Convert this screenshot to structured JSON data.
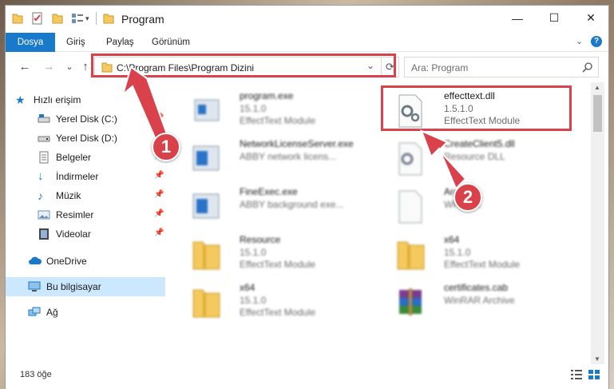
{
  "window": {
    "title": "Program",
    "controls": {
      "minimize": "—",
      "maximize": "☐",
      "close": "✕"
    }
  },
  "ribbon": {
    "tabs": [
      "Dosya",
      "Giriş",
      "Paylaş",
      "Görünüm"
    ],
    "collapse_icon": "chevron-down-icon",
    "help": "?"
  },
  "navigation": {
    "back": "←",
    "forward": "→",
    "recent": "⌄",
    "up": "↑",
    "address": "C:\\Program Files\\Program Dizini",
    "refresh": "⟳",
    "search_placeholder": "Ara: Program"
  },
  "sidebar": {
    "quick_access": "Hızlı erişim",
    "items": [
      {
        "label": "Yerel Disk (C:)",
        "icon": "drive-icon",
        "pinned": true
      },
      {
        "label": "Yerel Disk (D:)",
        "icon": "drive-icon",
        "pinned": true
      },
      {
        "label": "Belgeler",
        "icon": "documents-icon",
        "pinned": true
      },
      {
        "label": "İndirmeler",
        "icon": "downloads-icon",
        "pinned": true
      },
      {
        "label": "Müzik",
        "icon": "music-icon",
        "pinned": true
      },
      {
        "label": "Resimler",
        "icon": "pictures-icon",
        "pinned": true
      },
      {
        "label": "Videolar",
        "icon": "videos-icon",
        "pinned": true
      }
    ],
    "onedrive": "OneDrive",
    "this_pc": "Bu bilgisayar",
    "network": "Ağ"
  },
  "files": [
    {
      "name": "program.exe",
      "line2": "15.1.0",
      "line3": "EffectText Module",
      "icon": "exe-icon"
    },
    {
      "name": "effecttext.dll",
      "line2": "1.5.1.0",
      "line3": "EffectText Module",
      "icon": "dll-gear-icon"
    },
    {
      "name": "NetworkLicenseServer.exe",
      "line2": "ABBY network licens...",
      "line3": "",
      "icon": "exe-icon"
    },
    {
      "name": "CreateClient5.dll",
      "line2": "Resource DLL",
      "line3": "",
      "icon": "dll-gear-icon"
    },
    {
      "name": "FineExec.exe",
      "line2": "ABBY background exe...",
      "line3": "",
      "icon": "exe-icon"
    },
    {
      "name": "Arabic",
      "line2": "WRD F...",
      "line3": "",
      "icon": "file-icon"
    },
    {
      "name": "Resource",
      "line2": "15.1.0",
      "line3": "EffectText Module",
      "icon": "folder-zip-icon"
    },
    {
      "name": "x64",
      "line2": "15.1.0",
      "line3": "EffectText Module",
      "icon": "folder-zip-icon"
    },
    {
      "name": "x64",
      "line2": "15.1.0",
      "line3": "EffectText Module",
      "icon": "folder-zip-icon"
    },
    {
      "name": "certificates.cab",
      "line2": "WinRAR Archive",
      "line3": "",
      "icon": "winrar-icon"
    }
  ],
  "status": {
    "item_count": "183 öğe"
  },
  "annotations": {
    "step1": "1",
    "step2": "2",
    "color": "#d9424a"
  },
  "colors": {
    "accent": "#1979ca",
    "selected": "#cce8ff",
    "folder": "#f4c95d"
  }
}
